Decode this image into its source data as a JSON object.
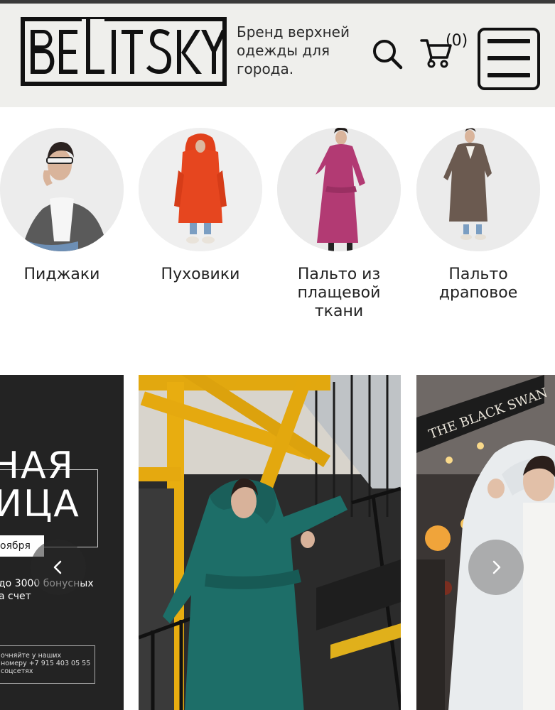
{
  "header": {
    "logo_text": "BELITSKY",
    "tagline": "Бренд верхней одежды для города.",
    "cart_count": "(0)",
    "icons": {
      "search": "search-icon",
      "cart": "cart-icon",
      "menu": "hamburger-menu-icon"
    }
  },
  "categories": [
    {
      "label": "Пиджаки"
    },
    {
      "label": "Пуховики"
    },
    {
      "label": "Пальто из плащевой ткани"
    },
    {
      "label": "Пальто драповое"
    }
  ],
  "banners": {
    "promo": {
      "title_line1": "НАЯ",
      "title_line2": "ИЦА",
      "date": "оября",
      "bonus_line1": "до 3000 бонусных",
      "bonus_line2": "а счет",
      "info_line1": "очняйте у наших",
      "info_line2": "номеру +7 915 403 05 55",
      "info_line3": "соцсетях"
    }
  },
  "carousel": {
    "prev_icon": "chevron-left-icon",
    "next_icon": "chevron-right-icon"
  },
  "colors": {
    "header_bg": "#efefec",
    "promo_bg": "#232323",
    "topbar": "#3a3a3a"
  }
}
